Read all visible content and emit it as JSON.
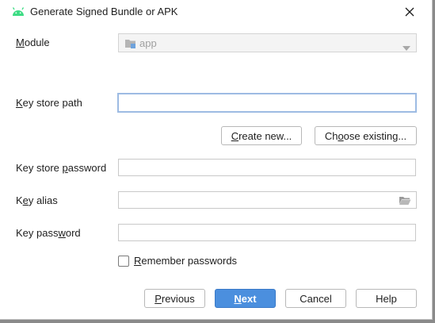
{
  "window": {
    "title": "Generate Signed Bundle or APK",
    "icon": "android-icon",
    "close_icon": "close-icon"
  },
  "module": {
    "label_mnemonic": "M",
    "label_rest": "odule",
    "value": "app",
    "enabled": false
  },
  "key_store_path": {
    "label_mnemonic": "K",
    "label_rest": "ey store path",
    "value": "",
    "focused": true
  },
  "actions": {
    "create_new_mnemonic": "C",
    "create_new_rest": "reate new...",
    "choose_existing_pre": "Ch",
    "choose_existing_mnemonic": "o",
    "choose_existing_rest": "ose existing..."
  },
  "key_store_password": {
    "label_pre": "Key store ",
    "label_mnemonic": "p",
    "label_rest": "assword",
    "value": ""
  },
  "key_alias": {
    "label_pre": "K",
    "label_mnemonic": "e",
    "label_rest": "y alias",
    "value": "",
    "browse_icon": "folder-icon"
  },
  "key_password": {
    "label_pre": "Key pass",
    "label_mnemonic": "w",
    "label_rest": "ord",
    "value": ""
  },
  "remember": {
    "label_mnemonic": "R",
    "label_rest": "emember passwords",
    "checked": false
  },
  "footer": {
    "previous_mnemonic": "P",
    "previous_rest": "revious",
    "next_mnemonic": "N",
    "next_rest": "ext",
    "cancel": "Cancel",
    "help": "Help"
  },
  "colors": {
    "primary_button": "#4b8fde",
    "focus_ring": "#9dbbe3",
    "android_green": "#3ddc84"
  }
}
